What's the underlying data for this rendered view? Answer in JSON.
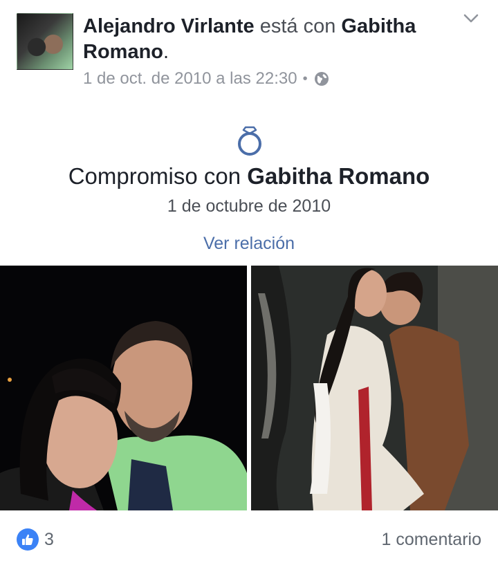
{
  "post": {
    "author": "Alejandro Virlante",
    "verb": "está con",
    "tagged_line1": "Gabitha",
    "tagged_line2": "Romano",
    "period": ".",
    "timestamp": "1 de oct. de 2010 a las 22:30",
    "separator": "•",
    "privacy_icon": "globe-icon",
    "menu_icon": "chevron-down-icon"
  },
  "life_event": {
    "icon": "ring-icon",
    "title_prefix": "Compromiso con",
    "title_name": "Gabitha Romano",
    "date": "1 de octubre de 2010",
    "link": "Ver relación"
  },
  "photos": [
    {
      "name": "couple-selfie-photo"
    },
    {
      "name": "theater-scene-photo"
    }
  ],
  "footer": {
    "like_icon": "thumbs-up-icon",
    "like_count": "3",
    "comments": "1 comentario"
  },
  "colors": {
    "link_blue": "#4b6ea9",
    "like_blue": "#3b82f6",
    "meta_gray": "#90949c"
  }
}
